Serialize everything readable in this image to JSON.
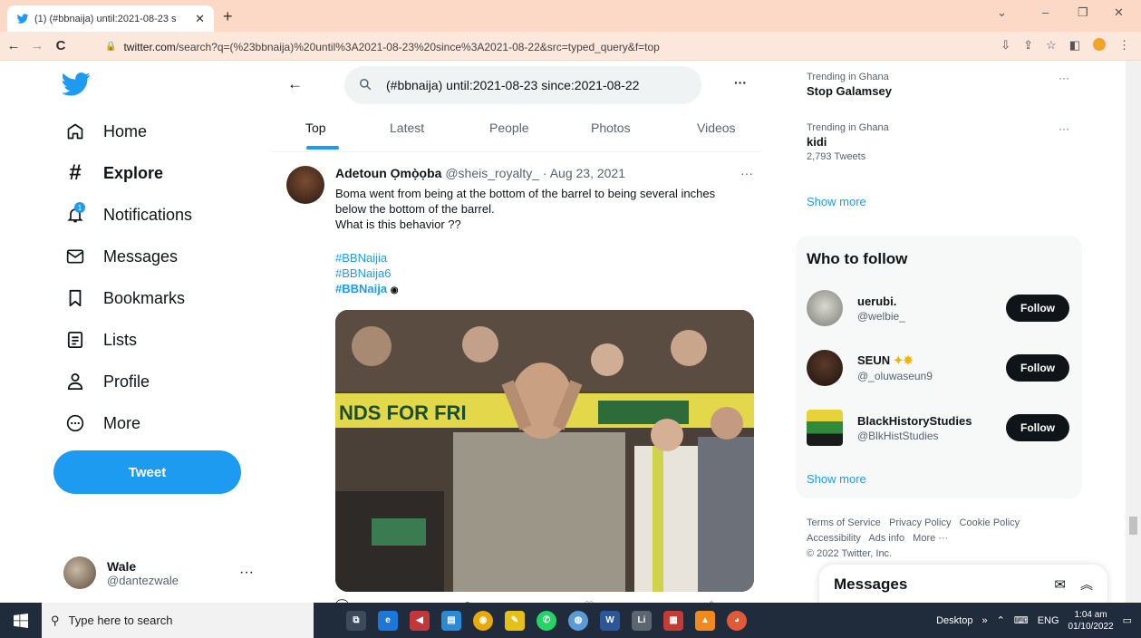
{
  "browser": {
    "tab_title": "(1) (#bbnaija) until:2021-08-23 s",
    "tab_close": "✕",
    "new_tab": "+",
    "url_host": "twitter.com",
    "url_path": "/search?q=(%23bbnaija)%20until%3A2021-08-23%20since%3A2021-08-22&src=typed_query&f=top",
    "back": "←",
    "forward": "→",
    "reload": "C",
    "win_collapse": "⌄",
    "win_minimize": "–",
    "win_restore": "❐",
    "win_close": "✕"
  },
  "nav": {
    "items": [
      {
        "label": "Home",
        "icon": "home-icon",
        "glyph": "⌂"
      },
      {
        "label": "Explore",
        "icon": "hashtag-icon",
        "glyph": "#"
      },
      {
        "label": "Notifications",
        "icon": "bell-icon",
        "glyph": "🔔",
        "badge": "1"
      },
      {
        "label": "Messages",
        "icon": "envelope-icon",
        "glyph": "✉"
      },
      {
        "label": "Bookmarks",
        "icon": "bookmark-icon",
        "glyph": "🔖"
      },
      {
        "label": "Lists",
        "icon": "list-icon",
        "glyph": "☰"
      },
      {
        "label": "Profile",
        "icon": "person-icon",
        "glyph": "👤"
      },
      {
        "label": "More",
        "icon": "more-circle-icon",
        "glyph": "⋯"
      }
    ],
    "tweet_button": "Tweet",
    "user": {
      "name": "Wale",
      "handle": "@dantezwale",
      "more": "···"
    }
  },
  "search": {
    "query": "(#bbnaija) until:2021-08-23 since:2021-08-22",
    "more": "···",
    "tabs": [
      "Top",
      "Latest",
      "People",
      "Photos",
      "Videos"
    ],
    "active_tab": "Top"
  },
  "tweet": {
    "display_name": "Adetoun Ọmọ̀ọba",
    "meta": "@sheis_royalty_ · Aug 23, 2021",
    "more": "···",
    "text_line1": "Boma went from being at the bottom of the barrel to being several inches",
    "text_line2": "below the bottom of the barrel.",
    "text_line3": "What is this behavior ??",
    "hashtags": [
      "#BBNaijia",
      "#BBNaija6",
      "#BBNaija"
    ],
    "banner_text": "NDS FOR FRI"
  },
  "trends": [
    {
      "context": "Trending in Ghana",
      "name": "Stop Galamsey",
      "count": ""
    },
    {
      "context": "Trending in Ghana",
      "name": "kidi",
      "count": "2,793 Tweets"
    }
  ],
  "trend_more": "···",
  "show_more": "Show more",
  "who_to_follow": {
    "title": "Who to follow",
    "users": [
      {
        "name": "uerubi.",
        "handle": "@welbie_"
      },
      {
        "name": "SEUN",
        "handle": "@_oluwaseun9"
      },
      {
        "name": "BlackHistoryStudies",
        "handle": "@BlkHistStudies"
      }
    ],
    "follow_label": "Follow",
    "show_more": "Show more"
  },
  "footer": {
    "links": [
      "Terms of Service",
      "Privacy Policy",
      "Cookie Policy",
      "Accessibility",
      "Ads info",
      "More ···"
    ],
    "copyright": "© 2022 Twitter, Inc."
  },
  "messages_dock": {
    "title": "Messages"
  },
  "taskbar": {
    "search_placeholder": "Type here to search",
    "desktop": "Desktop",
    "chevrons": "»",
    "lang": "ENG",
    "time": "1:04 am",
    "date": "01/10/2022"
  },
  "colors": {
    "accent": "#1d9bf0",
    "tabbar": "#fbd9c6",
    "taskbar": "#202b3b"
  }
}
